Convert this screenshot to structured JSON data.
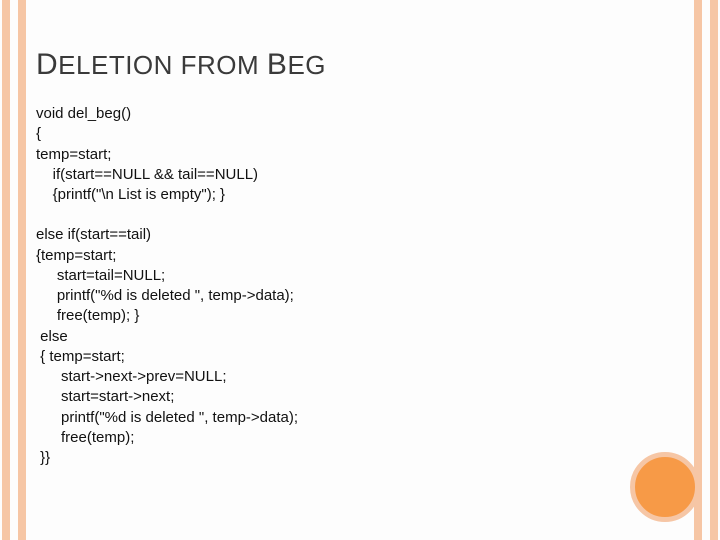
{
  "title_parts": {
    "d": "D",
    "eletion_from": "ELETION FROM ",
    "b": "B",
    "eg": "EG"
  },
  "code_block1": "void del_beg()\n{\ntemp=start;\n    if(start==NULL && tail==NULL)\n    {printf(\"\\n List is empty\"); }",
  "code_block2": "else if(start==tail)\n{temp=start;\n     start=tail=NULL;\n     printf(\"%d is deleted \", temp->data);\n     free(temp); }\n else\n { temp=start;\n      start->next->prev=NULL;\n      start=start->next;\n      printf(\"%d is deleted \", temp->data);\n      free(temp);\n }}"
}
